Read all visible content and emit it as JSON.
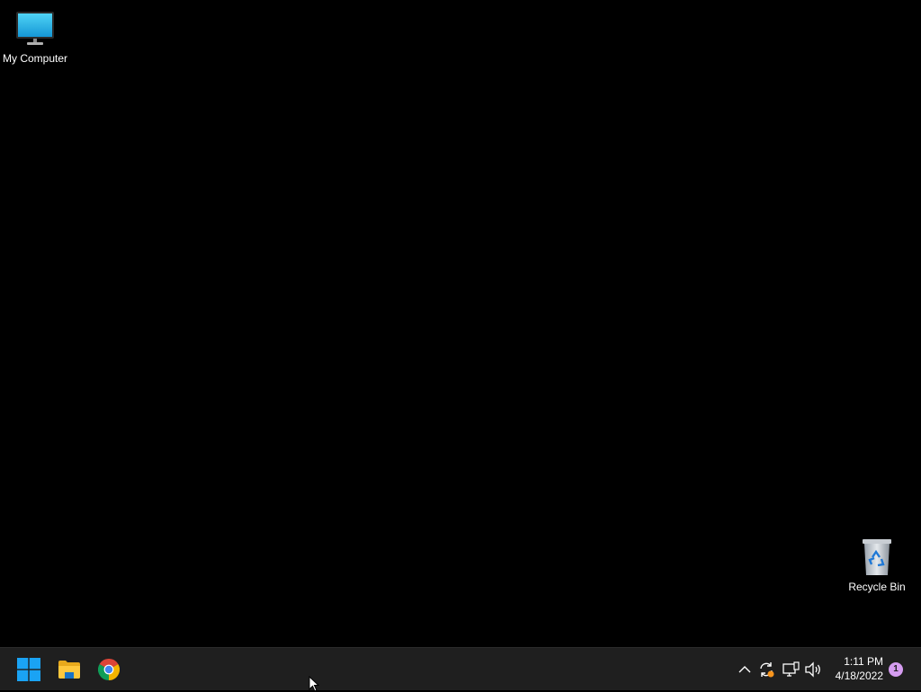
{
  "desktop": {
    "background_color": "#000000",
    "icons": [
      {
        "label": "My Computer",
        "icon": "monitor-icon"
      },
      {
        "label": "Recycle Bin",
        "icon": "recycle-bin-icon"
      }
    ]
  },
  "taskbar": {
    "background_color": "#1f1f1f",
    "pinned": [
      {
        "name": "Start",
        "icon": "windows-logo-icon"
      },
      {
        "name": "File Explorer",
        "icon": "folder-icon"
      },
      {
        "name": "Google Chrome",
        "icon": "chrome-icon"
      }
    ],
    "tray": {
      "icons": [
        "chevron-up-icon",
        "sync-icon",
        "network-icon",
        "volume-icon"
      ],
      "time": "1:11 PM",
      "date": "4/18/2022",
      "notification_count": "1"
    }
  }
}
